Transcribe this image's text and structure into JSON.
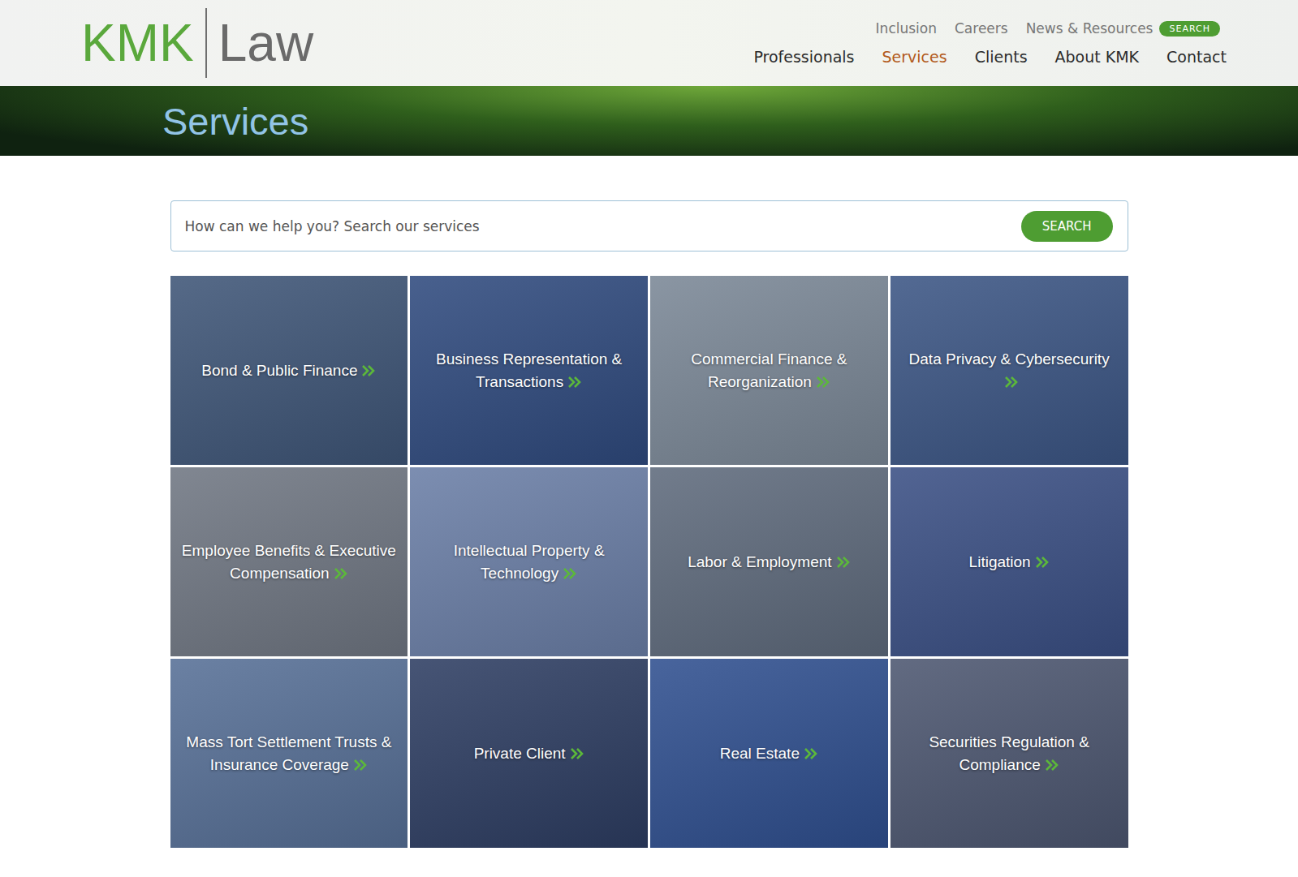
{
  "header": {
    "logo": {
      "primary": "KMK",
      "secondary": "Law"
    },
    "utility_nav": [
      {
        "label": "Inclusion"
      },
      {
        "label": "Careers"
      },
      {
        "label": "News & Resources"
      }
    ],
    "search_pill": "SEARCH",
    "main_nav": [
      {
        "label": "Professionals",
        "selected": false
      },
      {
        "label": "Services",
        "selected": true
      },
      {
        "label": "Clients",
        "selected": false
      },
      {
        "label": "About KMK",
        "selected": false
      },
      {
        "label": "Contact",
        "selected": false
      }
    ]
  },
  "banner": {
    "title": "Services"
  },
  "search": {
    "placeholder": "How can we help you? Search our services",
    "button": "SEARCH"
  },
  "services": [
    {
      "label": "Bond & Public Finance"
    },
    {
      "label": "Business Representation & Transactions"
    },
    {
      "label": "Commercial Finance & Reorganization"
    },
    {
      "label": "Data Privacy & Cybersecurity"
    },
    {
      "label": "Employee Benefits & Executive Compensation"
    },
    {
      "label": "Intellectual Property & Technology"
    },
    {
      "label": "Labor & Employment"
    },
    {
      "label": "Litigation"
    },
    {
      "label": "Mass Tort Settlement Trusts & Insurance Coverage"
    },
    {
      "label": "Private Client"
    },
    {
      "label": "Real Estate"
    },
    {
      "label": "Securities Regulation & Compliance"
    }
  ]
}
